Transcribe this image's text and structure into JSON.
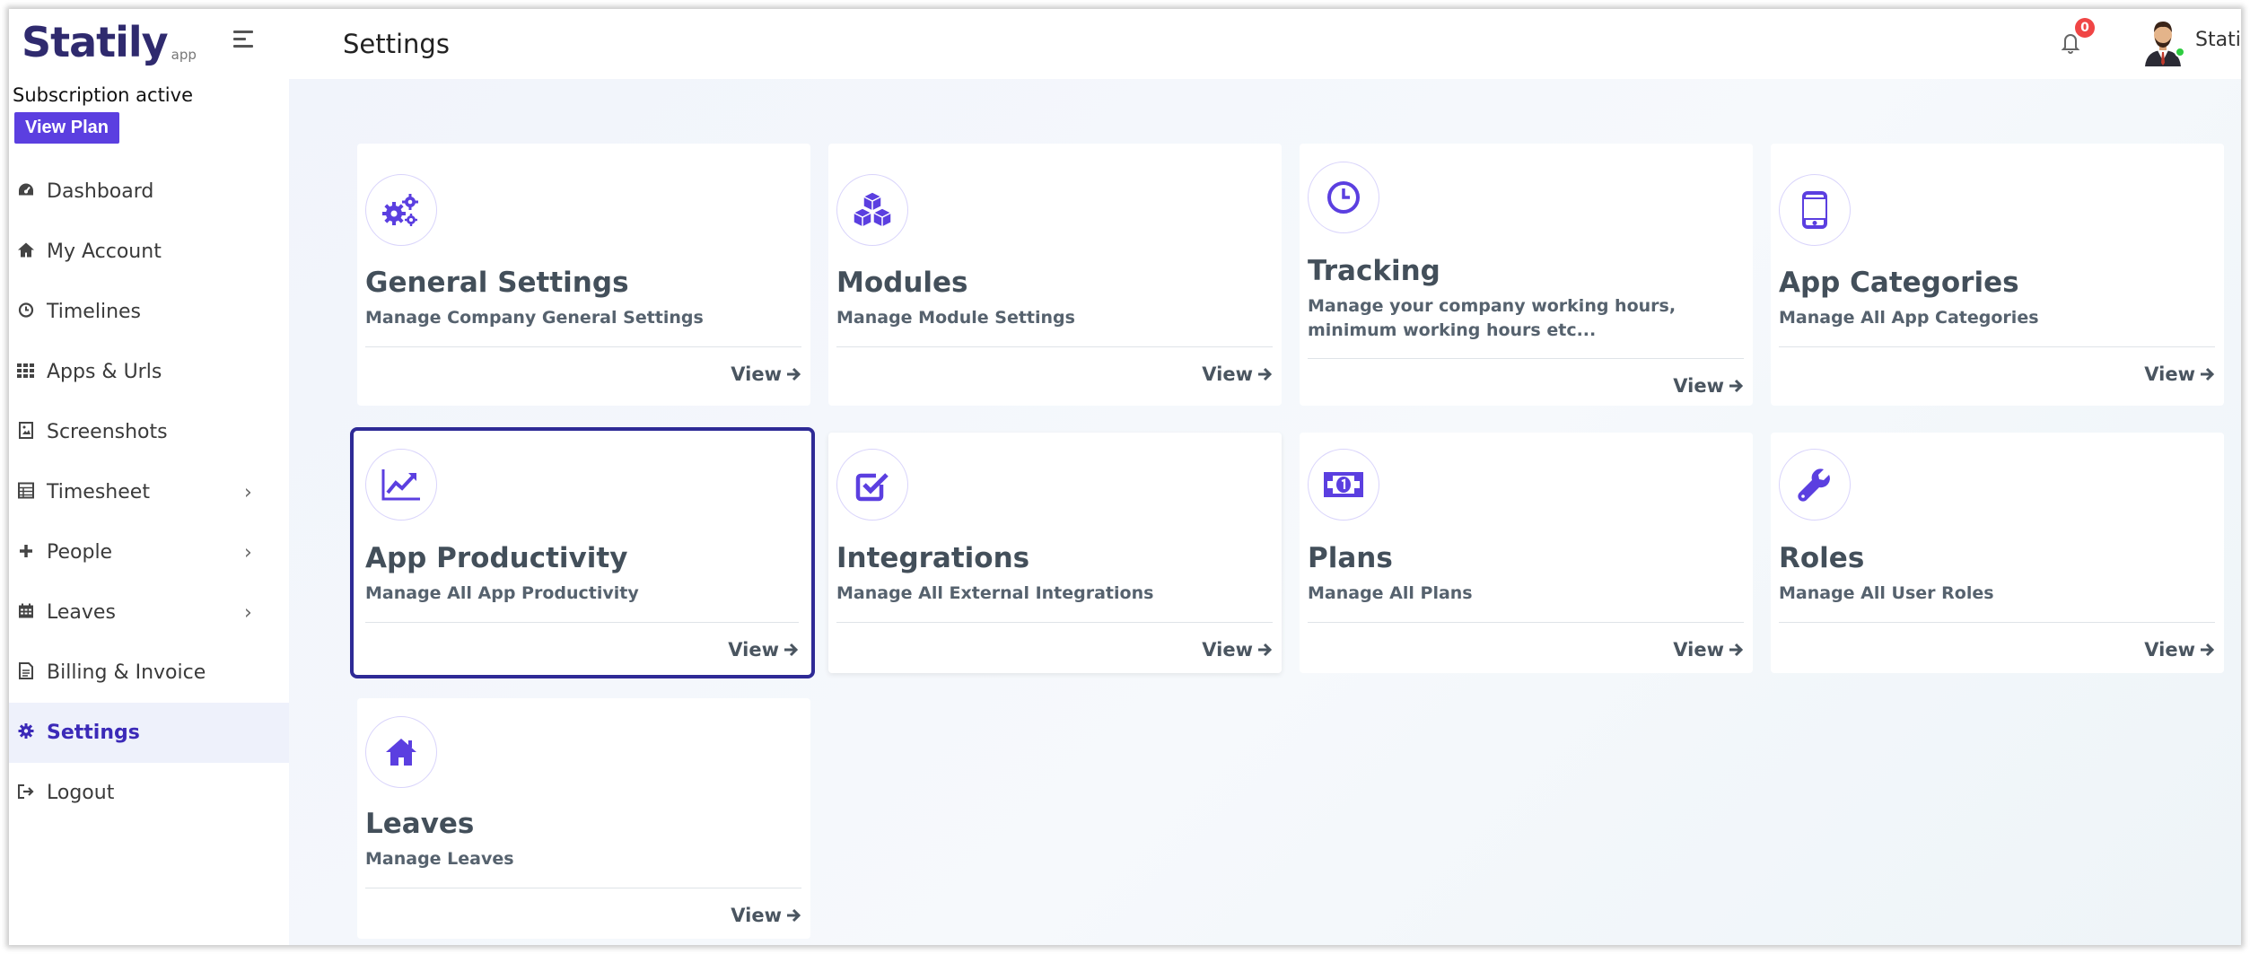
{
  "app": {
    "logo_text": "Statily",
    "logo_suffix": "app"
  },
  "subscription": {
    "status_text": "Subscription active",
    "view_plan_label": "View Plan"
  },
  "sidebar": {
    "items": [
      {
        "label": "Dashboard",
        "icon": "dashboard-icon"
      },
      {
        "label": "My Account",
        "icon": "home-icon"
      },
      {
        "label": "Timelines",
        "icon": "clock-icon"
      },
      {
        "label": "Apps & Urls",
        "icon": "grid-icon"
      },
      {
        "label": "Screenshots",
        "icon": "image-icon"
      },
      {
        "label": "Timesheet",
        "icon": "sheet-icon",
        "expandable": true
      },
      {
        "label": "People",
        "icon": "plus-icon",
        "expandable": true
      },
      {
        "label": "Leaves",
        "icon": "calendar-icon",
        "expandable": true
      },
      {
        "label": "Billing & Invoice",
        "icon": "file-icon"
      },
      {
        "label": "Settings",
        "icon": "gear-icon",
        "active": true
      },
      {
        "label": "Logout",
        "icon": "logout-icon"
      }
    ]
  },
  "header": {
    "title": "Settings",
    "notification_count": "0",
    "username": "Statily"
  },
  "cards": [
    {
      "title": "General Settings",
      "description": "Manage Company General Settings",
      "view_label": "View",
      "icon": "gears-icon"
    },
    {
      "title": "Modules",
      "description": "Manage Module Settings",
      "view_label": "View",
      "icon": "cubes-icon"
    },
    {
      "title": "Tracking",
      "description": "Manage your company working hours, minimum working hours etc...",
      "view_label": "View",
      "icon": "clock-icon"
    },
    {
      "title": "App Categories",
      "description": "Manage All App Categories",
      "view_label": "View",
      "icon": "mobile-icon"
    },
    {
      "title": "App Productivity",
      "description": "Manage All App Productivity",
      "view_label": "View",
      "icon": "line-chart-icon",
      "focused": true
    },
    {
      "title": "Integrations",
      "description": "Manage All External Integrations",
      "view_label": "View",
      "icon": "check-square-icon"
    },
    {
      "title": "Plans",
      "description": "Manage All Plans",
      "view_label": "View",
      "icon": "money-icon"
    },
    {
      "title": "Roles",
      "description": "Manage All User Roles",
      "view_label": "View",
      "icon": "wrench-icon"
    },
    {
      "title": "Leaves",
      "description": "Manage Leaves",
      "view_label": "View",
      "icon": "home-icon"
    }
  ],
  "colors": {
    "accent": "#5b3fe0",
    "active_nav": "#3b2ab8",
    "focus_outline": "#2e2a96",
    "badge": "#f04545"
  }
}
